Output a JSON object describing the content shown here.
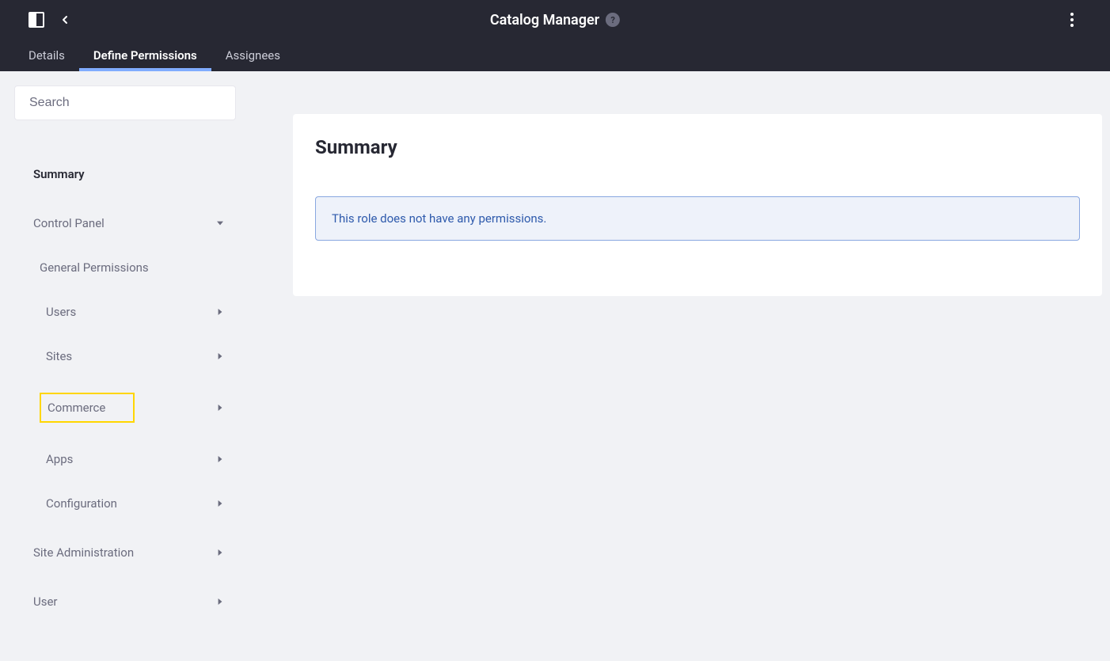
{
  "header": {
    "title": "Catalog Manager",
    "help_icon_char": "?",
    "tabs": [
      {
        "label": "Details",
        "active": false
      },
      {
        "label": "Define Permissions",
        "active": true
      },
      {
        "label": "Assignees",
        "active": false
      }
    ]
  },
  "sidebar": {
    "search_placeholder": "Search",
    "summary_label": "Summary",
    "groups": {
      "control_panel": {
        "label": "Control Panel",
        "children": {
          "general_permissions": {
            "label": "General Permissions"
          },
          "users": {
            "label": "Users"
          },
          "sites": {
            "label": "Sites"
          },
          "commerce": {
            "label": "Commerce"
          },
          "apps": {
            "label": "Apps"
          },
          "configuration": {
            "label": "Configuration"
          }
        }
      },
      "site_administration": {
        "label": "Site Administration"
      },
      "user": {
        "label": "User"
      }
    }
  },
  "main": {
    "card_title": "Summary",
    "info_message": "This role does not have any permissions."
  }
}
